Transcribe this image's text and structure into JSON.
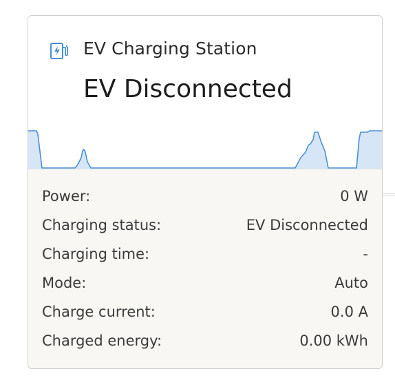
{
  "widget": {
    "icon": "ev-charger-icon",
    "title": "EV Charging Station",
    "status": "EV Disconnected",
    "accent_color": "#4a8fd4",
    "chart_fill_color": "#d7e6f6"
  },
  "details": [
    {
      "label": "Power:",
      "value": "0 W"
    },
    {
      "label": "Charging status:",
      "value": "EV Disconnected"
    },
    {
      "label": "Charging time:",
      "value": "-"
    },
    {
      "label": "Mode:",
      "value": "Auto"
    },
    {
      "label": "Charge current:",
      "value": "0.0 A"
    },
    {
      "label": "Charged energy:",
      "value": "0.00 kWh"
    }
  ]
}
